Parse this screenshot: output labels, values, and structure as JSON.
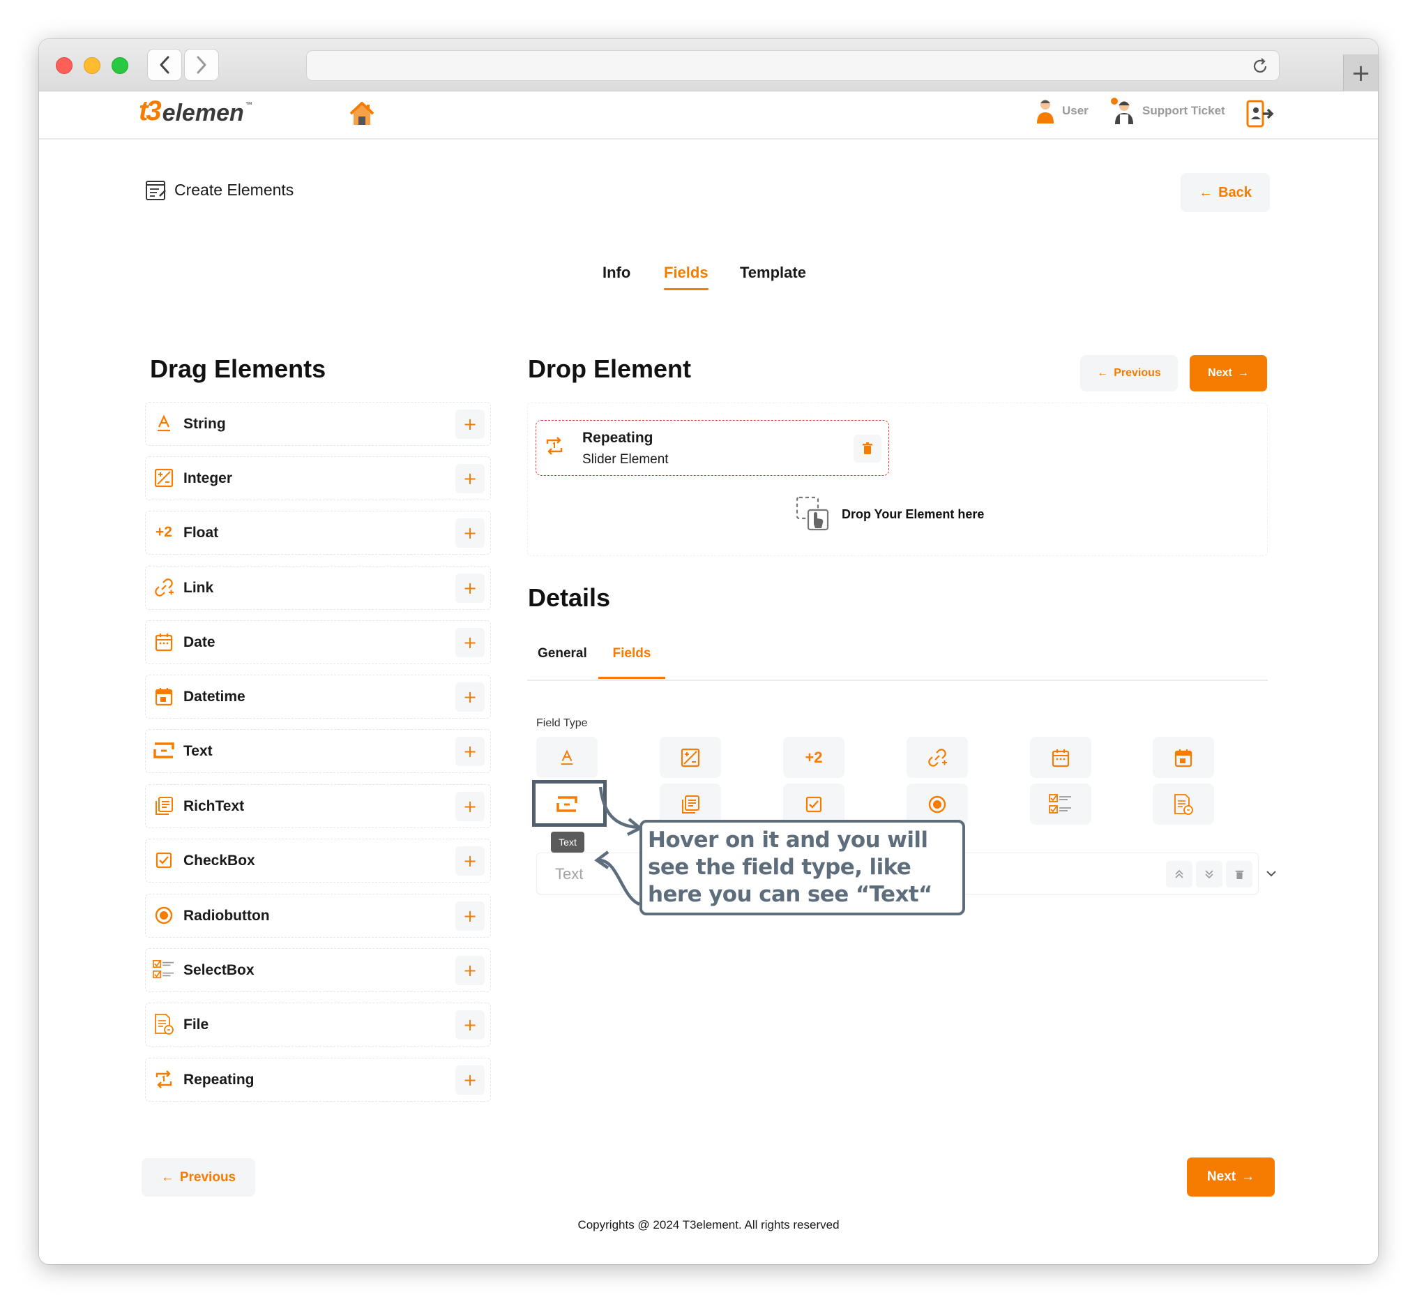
{
  "header": {
    "logo_main": "t3",
    "logo_word": "elemen",
    "logo_tm": "™",
    "user_label": "User",
    "support_label": "Support Ticket"
  },
  "page": {
    "title": "Create Elements",
    "back_label": "Back"
  },
  "tabs_top": [
    {
      "label": "Info",
      "active": false
    },
    {
      "label": "Fields",
      "active": true
    },
    {
      "label": "Template",
      "active": false
    }
  ],
  "drag": {
    "heading": "Drag Elements",
    "items": [
      {
        "label": "String",
        "icon": "string-icon"
      },
      {
        "label": "Integer",
        "icon": "integer-icon"
      },
      {
        "label": "Float",
        "icon": "float-icon",
        "glyph": "+2"
      },
      {
        "label": "Link",
        "icon": "link-icon"
      },
      {
        "label": "Date",
        "icon": "date-icon"
      },
      {
        "label": "Datetime",
        "icon": "datetime-icon"
      },
      {
        "label": "Text",
        "icon": "text-icon"
      },
      {
        "label": "RichText",
        "icon": "richtext-icon"
      },
      {
        "label": "CheckBox",
        "icon": "checkbox-icon"
      },
      {
        "label": "Radiobutton",
        "icon": "radiobutton-icon"
      },
      {
        "label": "SelectBox",
        "icon": "selectbox-icon"
      },
      {
        "label": "File",
        "icon": "file-icon"
      },
      {
        "label": "Repeating",
        "icon": "repeating-icon"
      }
    ],
    "add_symbol": "+"
  },
  "drop": {
    "heading": "Drop Element",
    "previous_label": "Previous",
    "next_label": "Next",
    "card_title": "Repeating",
    "card_subtitle": "Slider Element",
    "hint": "Drop Your Element here"
  },
  "details": {
    "heading": "Details",
    "tabs": [
      {
        "label": "General",
        "active": false
      },
      {
        "label": "Fields",
        "active": true
      }
    ],
    "field_type_label": "Field Type",
    "float_glyph": "+2",
    "field_value": "Text",
    "tooltip": "Text"
  },
  "annotation": {
    "callout_text": "Hover on it and you will see the field type, like here you can see “Text“"
  },
  "bottom": {
    "previous_label": "Previous",
    "next_label": "Next"
  },
  "footer": {
    "copyright": "Copyrights @ 2024 T3element. All rights reserved"
  },
  "colors": {
    "accent": "#f57c00",
    "danger": "#e53935",
    "annotation": "#5e6d7b"
  }
}
